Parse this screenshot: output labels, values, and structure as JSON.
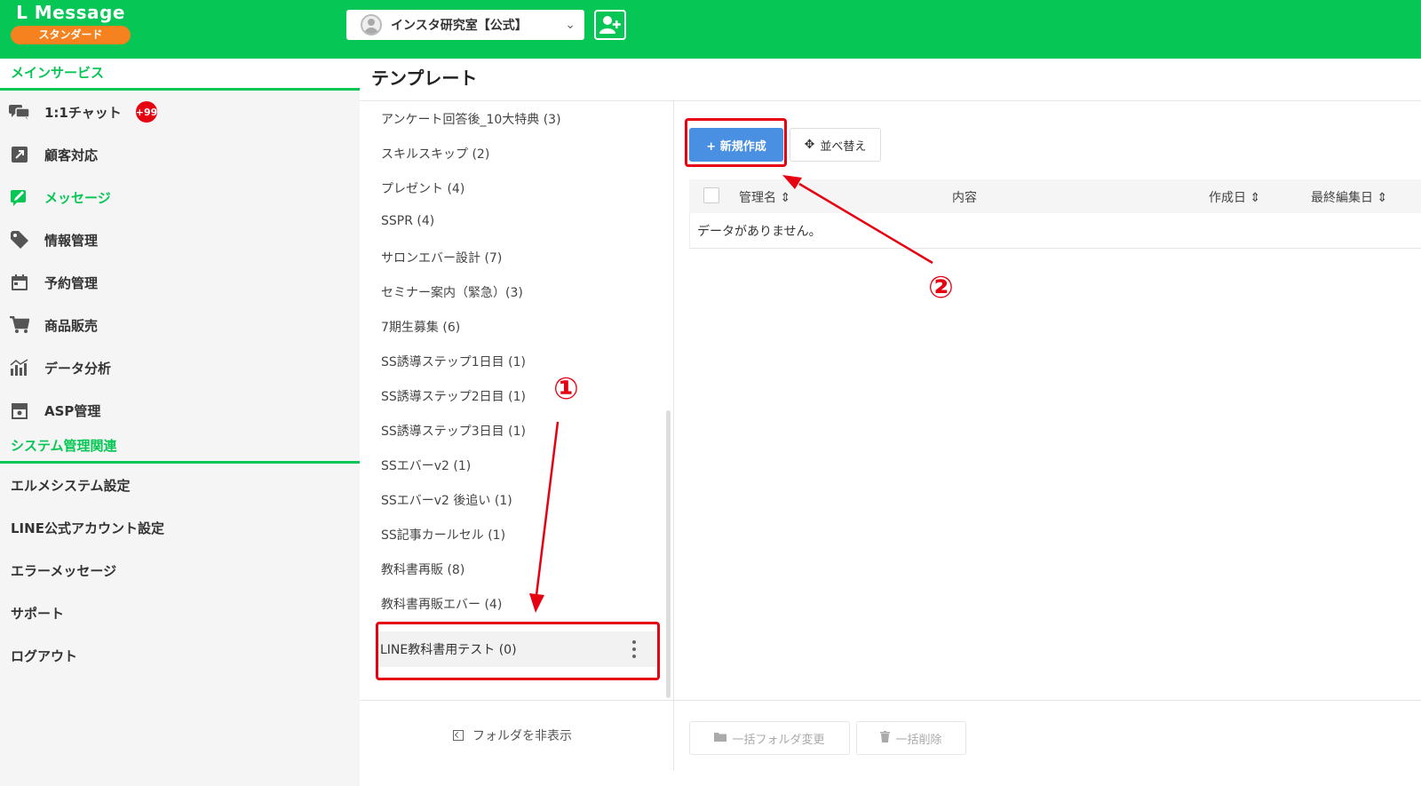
{
  "header": {
    "logo": "L Message",
    "plan": "スタンダード",
    "account": "インスタ研究室【公式】",
    "colors": {
      "brand": "#06c755",
      "plan_badge": "#f5821f"
    }
  },
  "sidebar": {
    "main_section": "メインサービス",
    "items": [
      {
        "label": "1:1チャット",
        "icon": "chat-icon",
        "badge": "+99"
      },
      {
        "label": "顧客対応",
        "icon": "external-link-icon"
      },
      {
        "label": "メッセージ",
        "icon": "message-edit-icon",
        "active": true
      },
      {
        "label": "情報管理",
        "icon": "tag-icon"
      },
      {
        "label": "予約管理",
        "icon": "calendar-icon"
      },
      {
        "label": "商品販売",
        "icon": "cart-icon"
      },
      {
        "label": "データ分析",
        "icon": "chart-icon"
      },
      {
        "label": "ASP管理",
        "icon": "archive-icon"
      }
    ],
    "system_section": "システム管理関連",
    "system_items": [
      "エルメシステム設定",
      "LINE公式アカウント設定",
      "エラーメッセージ",
      "サポート",
      "ログアウト"
    ]
  },
  "main": {
    "title": "テンプレート",
    "folders": [
      "アンケート回答後_10大特典 (3)",
      "スキルスキップ (2)",
      "プレゼント (4)",
      "SSPR (4)",
      "サロンエバー設計 (7)",
      "セミナー案内（緊急）(3)",
      "7期生募集 (6)",
      "SS誘導ステップ1日目 (1)",
      "SS誘導ステップ2日目 (1)",
      "SS誘導ステップ3日目 (1)",
      "SSエバーv2 (1)",
      "SSエバーv2 後追い (1)",
      "SS記事カールセル (1)",
      "教科書再販 (8)",
      "教科書再販エバー (4)"
    ],
    "selected_folder": "LINE教科書用テスト (0)",
    "hide_folders": "フォルダを非表示",
    "new_button": "+ 新規作成",
    "sort_button": "並べ替え",
    "table": {
      "columns": [
        "管理名",
        "内容",
        "作成日",
        "最終編集日"
      ],
      "empty": "データがありません。"
    },
    "bulk_folder": "一括フォルダ変更",
    "bulk_delete": "一括削除"
  },
  "annotations": {
    "marker1": "①",
    "marker2": "②",
    "color": "#e60012"
  }
}
